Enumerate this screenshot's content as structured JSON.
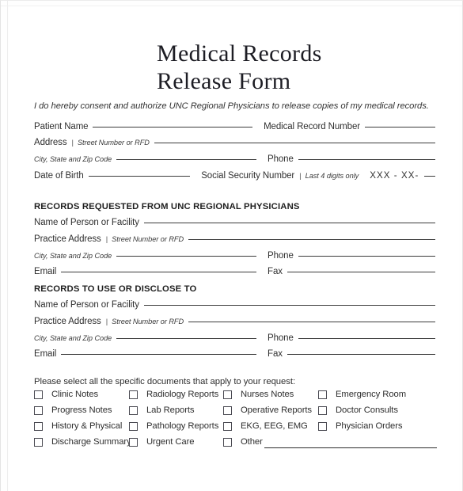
{
  "document": {
    "title_lines": [
      "Medical Records",
      "Release Form"
    ],
    "consent": "I do hereby consent and authorize UNC Regional Physicians to release copies of my medical records."
  },
  "patient": {
    "name_label": "Patient Name",
    "mrn_label": "Medical Record Number",
    "address_label": "Address",
    "address_hint": "Street Number or RFD",
    "city_label": "City, State and Zip Code",
    "phone_label": "Phone",
    "dob_label": "Date of Birth",
    "ssn_label": "Social Security Number",
    "ssn_hint": "Last 4 digits only",
    "ssn_mask": "XXX - XX-",
    "separator": "|"
  },
  "requested_from": {
    "heading": "RECORDS REQUESTED FROM UNC REGIONAL PHYSICIANS",
    "name_label": "Name of Person or Facility",
    "practice_label": "Practice Address",
    "practice_hint": "Street Number or RFD",
    "city_label": "City, State and Zip Code",
    "phone_label": "Phone",
    "email_label": "Email",
    "fax_label": "Fax",
    "separator": "|"
  },
  "disclose_to": {
    "heading": "RECORDS TO USE OR DISCLOSE TO",
    "name_label": "Name of Person or Facility",
    "practice_label": "Practice Address",
    "practice_hint": "Street Number or RFD",
    "city_label": "City, State and Zip Code",
    "phone_label": "Phone",
    "email_label": "Email",
    "fax_label": "Fax",
    "separator": "|"
  },
  "documents": {
    "instruction": "Please select all the specific documents that apply to your request:",
    "rows": [
      [
        "Clinic Notes",
        "Radiology Reports",
        "Nurses Notes",
        "Emergency Room"
      ],
      [
        "Progress Notes",
        "Lab Reports",
        "Operative Reports",
        "Doctor Consults"
      ],
      [
        "History & Physical",
        "Pathology Reports",
        "EKG, EEG, EMG",
        "Physician Orders"
      ],
      [
        "Discharge Summary",
        "Urgent Care",
        "Other",
        ""
      ]
    ]
  },
  "colors": {
    "page": "#ffffff",
    "text": "#2f2f2f",
    "rule": "#3b3b3b",
    "checkbox_border": "#4a4a52"
  }
}
